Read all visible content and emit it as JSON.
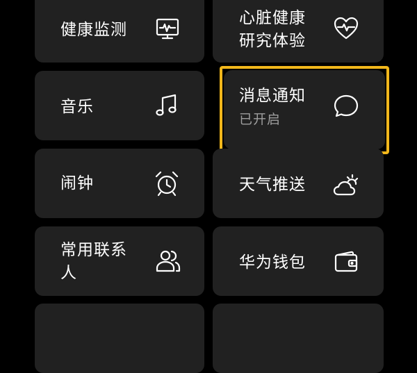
{
  "tiles": {
    "health_monitor": {
      "label": "健康监测",
      "icon": "monitor-waveform-icon"
    },
    "heart_health": {
      "label_line1": "心脏健康",
      "label_line2": "研究体验",
      "icon": "heart-pulse-icon"
    },
    "music": {
      "label": "音乐",
      "icon": "music-note-icon"
    },
    "notifications": {
      "label": "消息通知",
      "status": "已开启",
      "icon": "chat-bubble-icon"
    },
    "alarm": {
      "label": "闹钟",
      "icon": "alarm-clock-icon"
    },
    "weather": {
      "label": "天气推送",
      "icon": "weather-cloud-sun-icon"
    },
    "contacts": {
      "label_line1": "常用联系",
      "label_line2": "人",
      "icon": "contacts-icon"
    },
    "wallet": {
      "label": "华为钱包",
      "icon": "wallet-icon"
    }
  },
  "colors": {
    "background": "#000000",
    "tile": "#212121",
    "text": "#ffffff",
    "subtext": "#9e9e9e",
    "highlight": "#f2b71b"
  }
}
